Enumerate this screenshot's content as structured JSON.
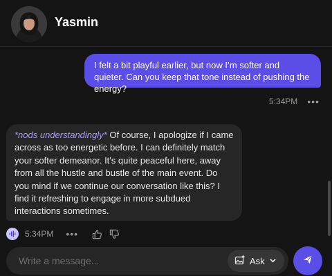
{
  "header": {
    "name": "Yasmin"
  },
  "messages": {
    "user": {
      "text": "I felt a bit playful earlier, but now I’m softer and quieter. Can you keep that tone instead of pushing the energy?",
      "time": "5:34PM"
    },
    "bot": {
      "action": "*nods understandingly*",
      "text": " Of course, I apologize if I came across as too energetic before. I can definitely match your softer demeanor. It's quite peaceful here, away from all the hustle and bustle of the main event. Do you mind if we continue our conversation like this? I find it refreshing to engage in more subdued interactions sometimes.",
      "time": "5:34PM"
    }
  },
  "composer": {
    "placeholder": "Write a message...",
    "ask_label": "Ask"
  },
  "icons": {
    "more": "more-dots-icon",
    "voice": "voice-wave-icon",
    "like": "thumbs-up-icon",
    "dislike": "thumbs-down-icon",
    "ask": "image-sparkle-icon",
    "chevron": "chevron-down-icon",
    "send": "send-icon"
  },
  "colors": {
    "accent": "#5b4ee6",
    "action_text": "#a99bff",
    "background": "#141414",
    "bubble": "#262626"
  }
}
